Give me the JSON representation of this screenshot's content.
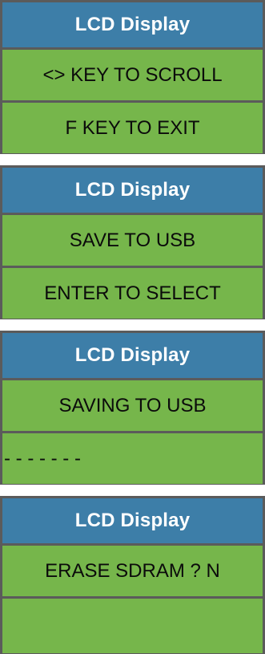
{
  "colors": {
    "border": "#5b5b5b",
    "header_bg": "#3d7ea8",
    "header_text": "#ffffff",
    "lcd_bg": "#76b64b",
    "lcd_text": "#0b0b0b"
  },
  "panels": [
    {
      "title": "LCD Display",
      "line1": "<> KEY TO SCROLL",
      "line2": "F KEY TO EXIT"
    },
    {
      "title": "LCD Display",
      "line1": "SAVE TO USB",
      "line2": "ENTER TO SELECT"
    },
    {
      "title": "LCD Display",
      "line1": "SAVING TO USB",
      "line2": "- - - - - - -"
    },
    {
      "title": "LCD Display",
      "line1": "ERASE SDRAM ? N",
      "line2": ""
    }
  ]
}
